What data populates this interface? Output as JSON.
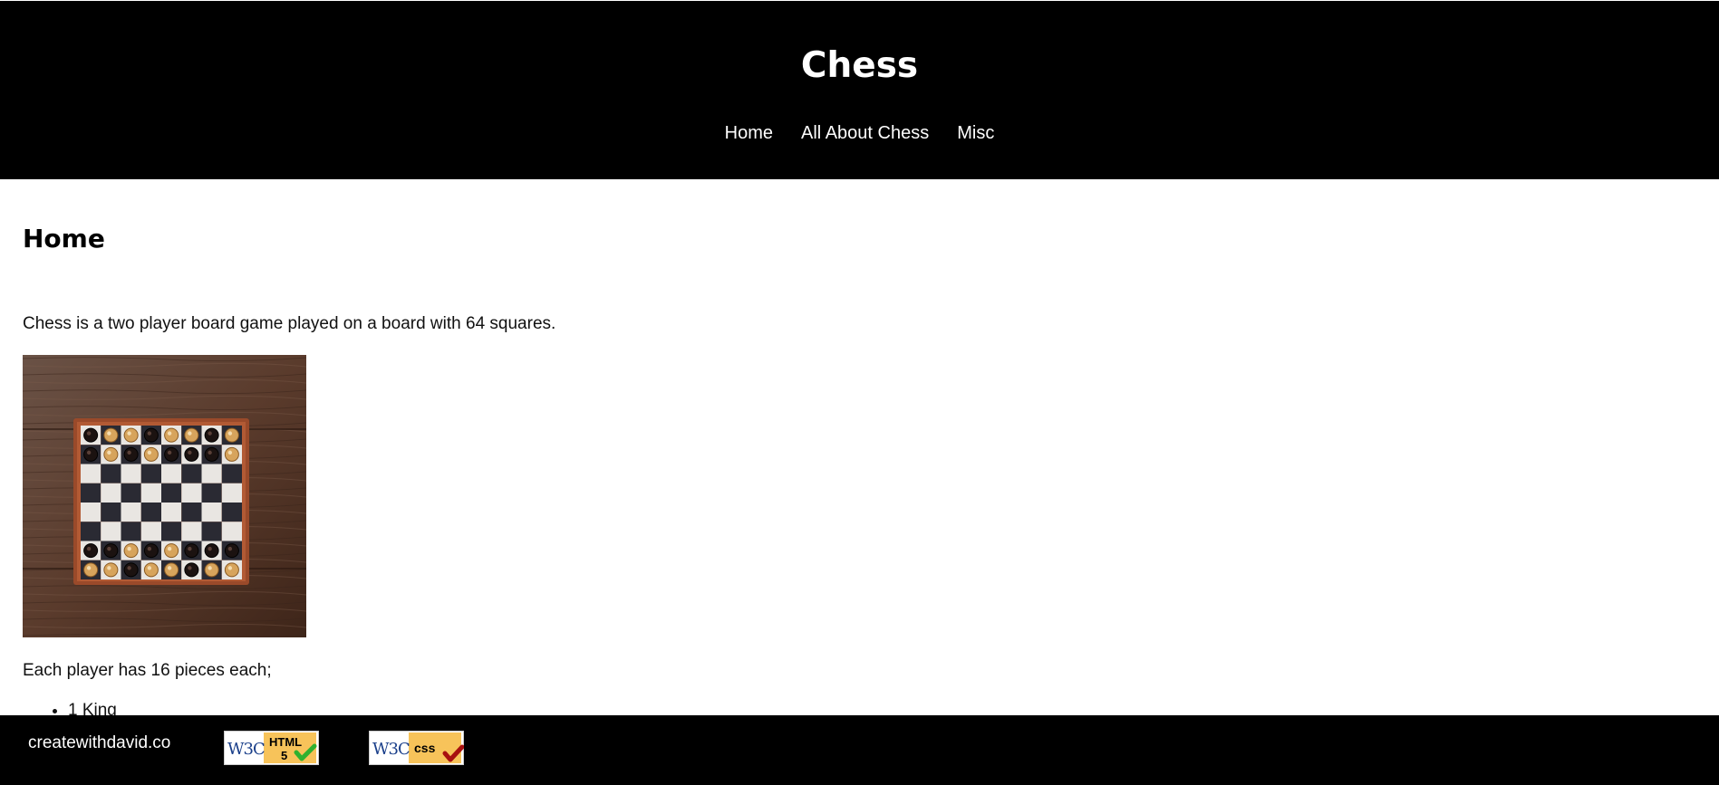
{
  "header": {
    "title": "Chess",
    "nav": [
      {
        "label": "Home"
      },
      {
        "label": "All About Chess"
      },
      {
        "label": "Misc"
      }
    ]
  },
  "main": {
    "heading": "Home",
    "intro": "Chess is a two player board game played on a board with 64 squares.",
    "pieces_intro": "Each player has 16 pieces each;",
    "pieces_list": [
      "1 King"
    ]
  },
  "footer": {
    "domain": "createwithdavid.co",
    "badges": [
      {
        "icon": "w3c-html5-badge-icon",
        "logo": "W3C",
        "label": "HTML",
        "sublabel": "5"
      },
      {
        "icon": "w3c-css-badge-icon",
        "logo": "W3C",
        "label": "css"
      }
    ]
  },
  "colors": {
    "header_bg": "#000000",
    "footer_bg": "#000000",
    "text": "#111111",
    "badge_yellow": "#f7c35a",
    "check_green": "#2fb12f",
    "check_red": "#a81010"
  }
}
